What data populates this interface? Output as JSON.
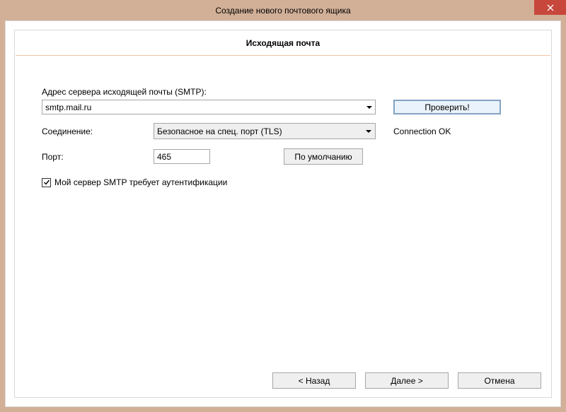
{
  "titlebar": {
    "title": "Создание нового почтового ящика"
  },
  "heading": "Исходящая почта",
  "form": {
    "smtp_label": "Адрес сервера исходящей почты (SMTP):",
    "smtp_value": "smtp.mail.ru",
    "connection_label": "Соединение:",
    "connection_value": "Безопасное на спец. порт (TLS)",
    "port_label": "Порт:",
    "port_value": "465",
    "default_button": "По умолчанию",
    "verify_button": "Проверить!",
    "status_text": "Connection OK",
    "auth_checkbox_label": "Мой сервер SMTP требует аутентификации",
    "auth_checked": true
  },
  "footer": {
    "back": "<  Назад",
    "next": "Далее  >",
    "cancel": "Отмена"
  }
}
